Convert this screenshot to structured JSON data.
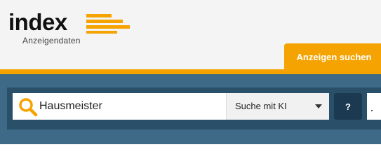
{
  "logo": {
    "word": "index",
    "subtitle": "Anzeigendaten",
    "accent_color": "#f5a300"
  },
  "nav": {
    "tabs": [
      {
        "label": "Anzeigen suchen",
        "active": true
      }
    ]
  },
  "search": {
    "query_value": "Hausmeister",
    "icon": "search-icon",
    "mode_select": {
      "selected": "Suche mit KI"
    },
    "help_label": "?"
  },
  "colors": {
    "header_bg": "#f4f4f4",
    "accent": "#f5a300",
    "search_band": "#3e6a87",
    "search_panel": "#2a5069",
    "help_button": "#1b3a52"
  }
}
